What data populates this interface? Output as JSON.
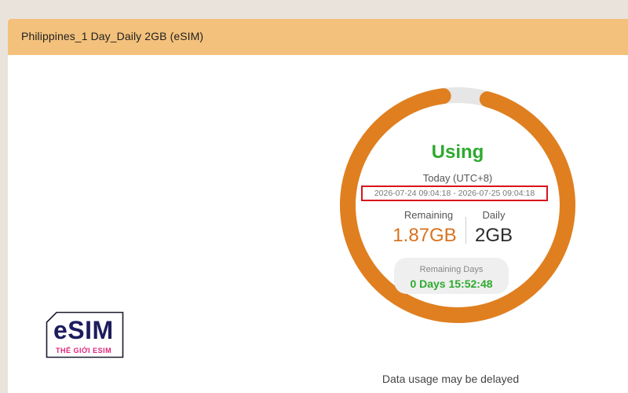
{
  "header": {
    "title": "Philippines_1 Day_Daily 2GB (eSIM)"
  },
  "usage": {
    "status": "Using",
    "period_label": "Today (UTC+8)",
    "period_range": "2026-07-24 09:04:18 - 2026-07-25 09:04:18",
    "remaining_label": "Remaining",
    "remaining_value": "1.87GB",
    "daily_label": "Daily",
    "daily_value": "2GB",
    "remaining_fraction": 0.935,
    "remaining_days_label": "Remaining Days",
    "remaining_days_value": "0 Days 15:52:48"
  },
  "note": "Data usage may be delayed",
  "logo": {
    "main": "eSIM",
    "sub": "THẾ GIỚI ESIM"
  },
  "colors": {
    "header": "#f3c17c",
    "gauge_used": "#e07f1f",
    "gauge_track": "#e6e6e6",
    "status": "#2eaa2e",
    "highlight_border": "#d8141c"
  }
}
